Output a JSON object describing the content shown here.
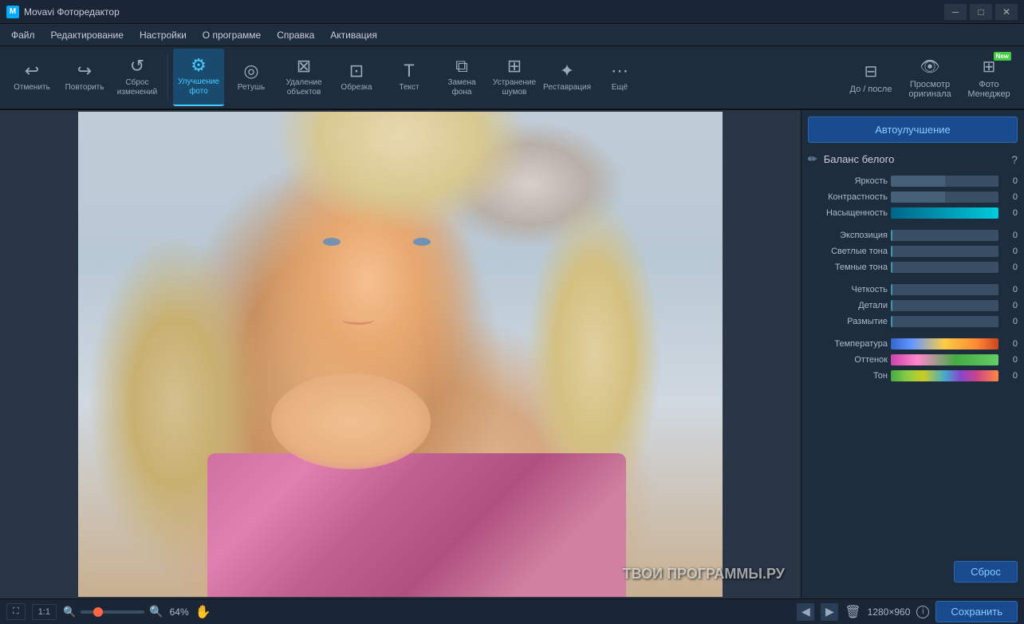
{
  "titlebar": {
    "title": "Movavi Фоторедактор",
    "controls": {
      "minimize": "─",
      "maximize": "□",
      "close": "✕"
    }
  },
  "menubar": {
    "items": [
      "Файл",
      "Редактирование",
      "Настройки",
      "О программе",
      "Справка",
      "Активация"
    ]
  },
  "toolbar": {
    "undo_label": "Отменить",
    "redo_label": "Повторить",
    "reset_label": "Сброс\nизменений",
    "enhance_label": "Улучшение\nфото",
    "retouch_label": "Ретушь",
    "remove_label": "Удаление\nобъектов",
    "crop_label": "Обрезка",
    "text_label": "Текст",
    "bg_label": "Замена\nфона",
    "denoise_label": "Устранение\nшумов",
    "restore_label": "Реставрация",
    "more_label": "Ещё",
    "before_after_label": "До / после",
    "preview_label": "Просмотр\nоригинала",
    "photo_manager_label": "Фото\nМенеджер",
    "new_badge": "New"
  },
  "right_panel": {
    "auto_enhance_btn": "Автоулучшение",
    "section_title": "Баланс белого",
    "help_icon": "?",
    "sliders": [
      {
        "label": "Яркость",
        "value": "0",
        "type": "grey"
      },
      {
        "label": "Контрастность",
        "value": "0",
        "type": "grey"
      },
      {
        "label": "Насыщенность",
        "value": "0",
        "type": "cyan"
      },
      {
        "label": "Экспозиция",
        "value": "0",
        "type": "grey"
      },
      {
        "label": "Светлые тона",
        "value": "0",
        "type": "grey"
      },
      {
        "label": "Темные тона",
        "value": "0",
        "type": "grey"
      },
      {
        "label": "Четкость",
        "value": "0",
        "type": "grey"
      },
      {
        "label": "Детали",
        "value": "0",
        "type": "grey"
      },
      {
        "label": "Размытие",
        "value": "0",
        "type": "grey"
      },
      {
        "label": "Температура",
        "value": "0",
        "type": "temperature"
      },
      {
        "label": "Оттенок",
        "value": "0",
        "type": "tint"
      },
      {
        "label": "Тон",
        "value": "0",
        "type": "tone"
      }
    ],
    "reset_btn": "Сброс"
  },
  "statusbar": {
    "fit_btn": "⛶",
    "ratio_btn": "1:1",
    "zoom_value": "64%",
    "image_size": "1280×960",
    "save_btn": "Сохранить",
    "watermark": "ТВОИ ПРОГРАММЫ.РУ"
  }
}
